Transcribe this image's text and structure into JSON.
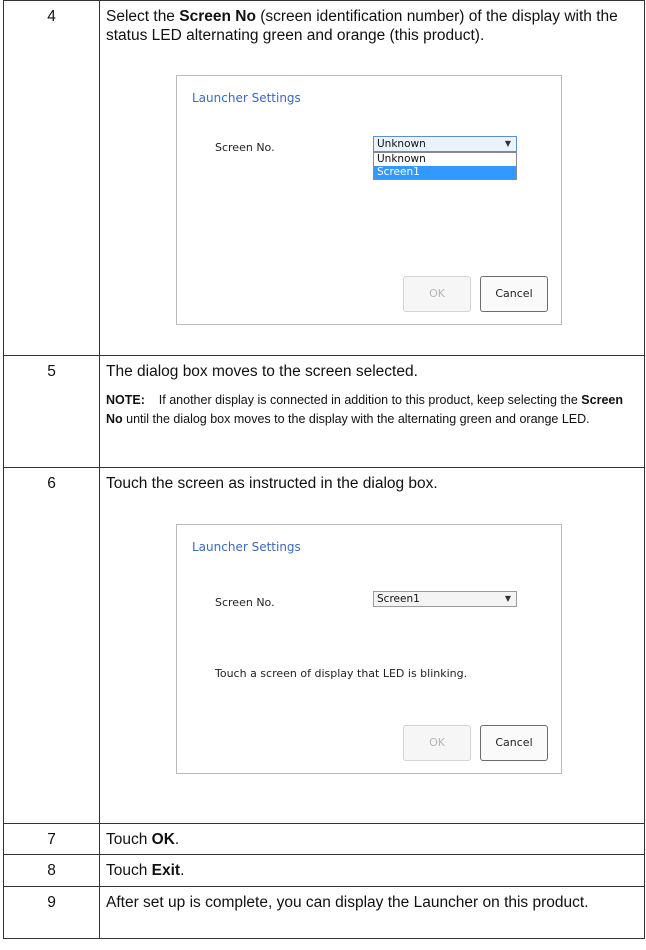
{
  "steps": [
    {
      "number": "4",
      "text_before": "Select the ",
      "bold": "Screen No",
      "text_after": " (screen identification number) of the display with the status LED alternating green and orange (this product).",
      "dialog": {
        "title": "Launcher Settings",
        "screen_label": "Screen No.",
        "selected_value": "Unknown",
        "options": [
          "Unknown",
          "Screen1"
        ],
        "highlighted_option": "Screen1",
        "ok_label": "OK",
        "cancel_label": "Cancel"
      }
    },
    {
      "number": "5",
      "text": "The dialog box moves to the screen selected.",
      "note_label": "NOTE:",
      "note_before": "If another display is connected in addition to this product, keep selecting the ",
      "note_bold": "Screen No",
      "note_after": " until the dialog box moves to the display with the alternating green and orange LED."
    },
    {
      "number": "6",
      "text": "Touch the screen as instructed in the dialog box.",
      "dialog": {
        "title": "Launcher Settings",
        "screen_label": "Screen No.",
        "selected_value": "Screen1",
        "instruction": "Touch a screen of display that LED is blinking.",
        "ok_label": "OK",
        "cancel_label": "Cancel"
      }
    },
    {
      "number": "7",
      "text_before": "Touch ",
      "bold": "OK",
      "text_after": "."
    },
    {
      "number": "8",
      "text_before": "Touch ",
      "bold": "Exit",
      "text_after": "."
    },
    {
      "number": "9",
      "text": "After set up is complete, you can display the Launcher on this product."
    }
  ]
}
